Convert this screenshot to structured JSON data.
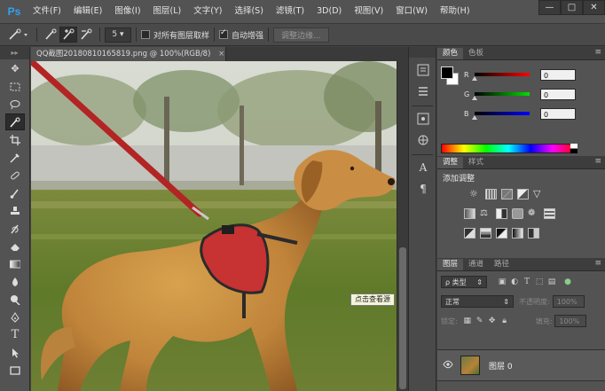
{
  "app": {
    "logo": "Ps"
  },
  "menu": [
    "文件(F)",
    "编辑(E)",
    "图像(I)",
    "图层(L)",
    "文字(Y)",
    "选择(S)",
    "滤镜(T)",
    "3D(D)",
    "视图(V)",
    "窗口(W)",
    "帮助(H)"
  ],
  "window_buttons": {
    "minimize": "—",
    "maximize": "□",
    "close": "✕"
  },
  "options": {
    "brush_size": "5",
    "sample_all_layers": "对所有图层取样",
    "sample_all_layers_checked": false,
    "auto_enhance": "自动增强",
    "auto_enhance_checked": true,
    "refine_edge": "调整边缘..."
  },
  "tools": [
    "move-icon",
    "marquee-icon",
    "lasso-icon",
    "quick-selection-icon",
    "crop-icon",
    "eyedropper-icon",
    "healing-brush-icon",
    "brush-icon",
    "clone-stamp-icon",
    "history-brush-icon",
    "eraser-icon",
    "gradient-icon",
    "blur-icon",
    "dodge-icon",
    "pen-icon",
    "type-icon",
    "path-selection-icon",
    "rectangle-icon"
  ],
  "document": {
    "tab_title": "QQ截图20180810165819.png @ 100%(RGB/8)",
    "close": "×"
  },
  "tooltip": "点击查看源",
  "color_panel": {
    "tabs": [
      "颜色",
      "色板"
    ],
    "r_label": "R",
    "r_value": "0",
    "g_label": "G",
    "g_value": "0",
    "b_label": "B",
    "b_value": "0"
  },
  "adjustments_panel": {
    "tabs": [
      "调整",
      "样式"
    ],
    "title": "添加调整"
  },
  "layers_panel": {
    "tabs": [
      "图层",
      "通道",
      "路径"
    ],
    "filter_kind": "ρ 类型",
    "blend_mode": "正常",
    "opacity_label": "不透明度:",
    "opacity_value": "100%",
    "lock_label": "锁定:",
    "fill_label": "填充:",
    "fill_value": "100%",
    "layer_name": "图层 0"
  }
}
